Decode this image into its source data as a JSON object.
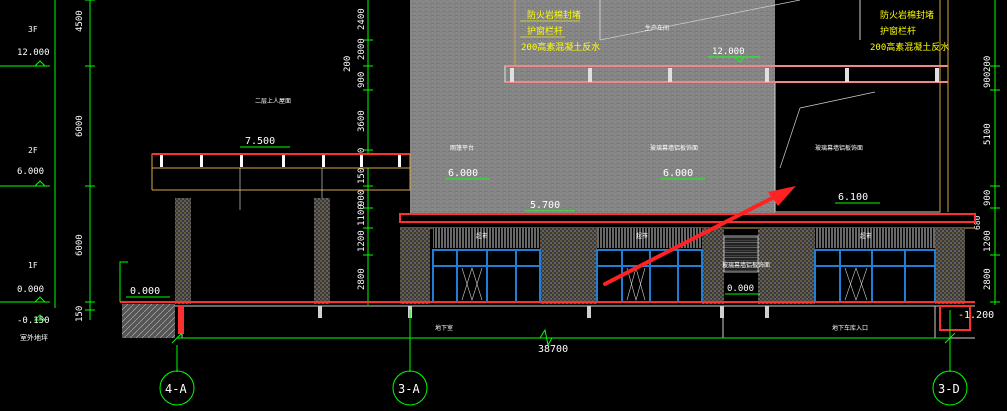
{
  "levels": {
    "f3": "3F",
    "elev_12": "12.000",
    "f2": "2F",
    "elev_6": "6.000",
    "f1": "1F",
    "elev_0": "0.000",
    "elev_m015": "-0.150",
    "outdoor": "室外地坪"
  },
  "vertical_dims": {
    "left_4500": "4500",
    "left_6000_upper": "6000",
    "left_6000_lower": "6000",
    "left_150": "150",
    "mid_2400": "2400",
    "mid_2000": "2000",
    "mid_200": "200",
    "mid_900": "900",
    "mid_3600": "3600",
    "mid_900b": "900",
    "mid_1500": "1500",
    "mid_900c": "900",
    "mid_1100": "1100",
    "mid_1200": "1200",
    "mid_2800": "2800",
    "right_200": "200",
    "right_900": "900",
    "right_5100": "5100",
    "right_900b": "900",
    "right_1200": "1200",
    "right_2800": "2800",
    "right_680": "680"
  },
  "annotations": {
    "fire_board_1": "防火岩棉封堵",
    "railing_1": "护窗栏杆",
    "wall_200_1": "200高素混凝土反水",
    "fire_board_2": "防火岩棉封堵",
    "railing_2": "护窗栏杆",
    "wall_200_2": "200高素混凝土反水",
    "mid_label_top": "生产车间",
    "elev_12_mid": "12.000",
    "roof_garden": "二层上人屋面",
    "canopy_elev": "7.500",
    "label_a": "雨篷平台",
    "label_b": "玻璃幕墙铝板饰面",
    "label_c": "玻璃幕墙铝板饰面",
    "elev_6_a": "6.000",
    "elev_5_7": "5.700",
    "elev_6_b": "6.000",
    "elev_6_1": "6.100",
    "shop_1": "超市",
    "shop_2": "超市",
    "shop_3": "超市",
    "mid_facade": "玻璃幕墙铝板饰面",
    "elev_0_mid": "0.000",
    "elev_m12": "-1.200",
    "basement_1": "地下室",
    "basement_2": "地下车库入口"
  },
  "bottom_dim": "38700",
  "axes": {
    "a1": "4-A",
    "a2": "3-A",
    "a3": "3-D"
  },
  "colors": {
    "background": "#000000",
    "green": "#00ff00",
    "red": "#ff2020",
    "yellow": "#ffff00",
    "white": "#ffffff",
    "blue": "#1f7fd6",
    "gray": "#8a8a8a",
    "arrow": "#ff2222"
  }
}
